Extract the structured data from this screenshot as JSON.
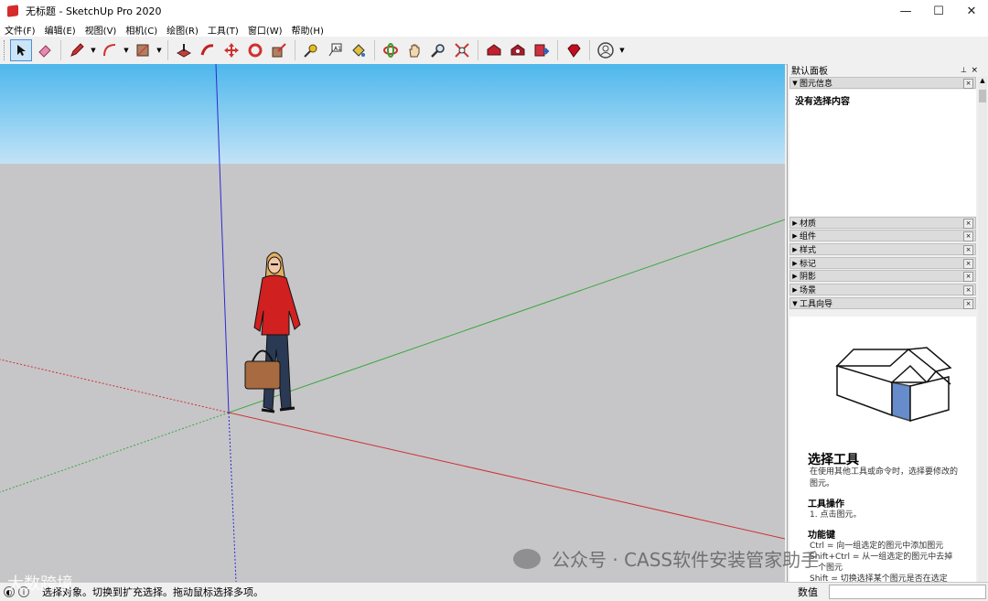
{
  "window": {
    "title": "无标题 - SketchUp Pro 2020",
    "minimize": "—",
    "maximize": "☐",
    "close": "✕"
  },
  "menu": [
    "文件(F)",
    "编辑(E)",
    "视图(V)",
    "相机(C)",
    "绘图(R)",
    "工具(T)",
    "窗口(W)",
    "帮助(H)"
  ],
  "toolbar": {
    "tools": [
      "select-icon",
      "eraser-icon",
      "pencil-icon",
      "arc-icon",
      "rectangle-icon",
      "push-pull-icon",
      "follow-me-icon",
      "move-icon",
      "rotate-icon",
      "scale-icon",
      "tape-measure-icon",
      "text-icon",
      "paint-bucket-icon",
      "orbit-icon",
      "pan-icon",
      "zoom-icon",
      "zoom-extents-icon",
      "warehouse-icon",
      "extension-warehouse-icon",
      "send-to-layout-icon",
      "ruby-icon",
      "account-icon"
    ],
    "active_tool": "select-icon"
  },
  "panel": {
    "title": "默认面板",
    "pin": "⊥",
    "close": "×",
    "entity_info": {
      "label": "图元信息",
      "content": "没有选择内容"
    },
    "trays": [
      "材质",
      "组件",
      "样式",
      "标记",
      "阴影",
      "场景"
    ],
    "instructor": {
      "label": "工具向导",
      "title": "选择工具",
      "description": "在使用其他工具或命令时，选择要修改的图元。",
      "ops_heading": "工具操作",
      "ops": [
        "1. 点击图元。"
      ],
      "keys_heading": "功能键",
      "keys": [
        "Ctrl = 向一组选定的图元中添加图元",
        "Shift+Ctrl = 从一组选定的图元中去掉",
        "一个图元",
        "Shift = 切换选择某个图元是否在选定"
      ]
    }
  },
  "status": {
    "text": "选择对象。切换到扩充选择。拖动鼠标选择多项。",
    "measure_label": "数值",
    "measure_value": ""
  },
  "watermark": {
    "text": "公众号 · CASS软件安装管家助手",
    "text2": "大数跨境"
  },
  "colors": {
    "sky_top": "#4db7ec",
    "ground": "#c6c6c9",
    "axis_red": "#d03030",
    "axis_green": "#3aa83a",
    "axis_blue": "#2b2bd0",
    "accent": "#4a8fd6"
  }
}
